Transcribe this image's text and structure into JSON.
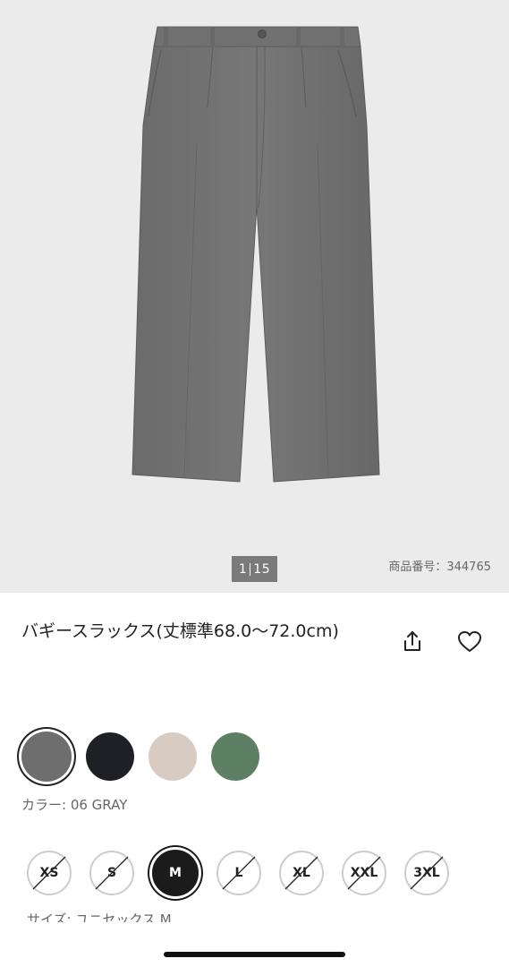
{
  "gallery": {
    "image_alt": "gray baggy slacks",
    "pager_current": "1",
    "pager_total": "15",
    "product_number": "商品番号：344765"
  },
  "product": {
    "title": "バギースラックス(丈標準68.0～72.0cm)",
    "share_icon": "share-icon",
    "favorite_icon": "heart-icon"
  },
  "colors": {
    "swatches": [
      {
        "name": "06 GRAY",
        "hex": "#6e6e6e",
        "selected": true
      },
      {
        "name": "black",
        "hex": "#1f2025",
        "selected": false
      },
      {
        "name": "beige",
        "hex": "#d8ccc2",
        "selected": false
      },
      {
        "name": "green",
        "hex": "#5d7f63",
        "selected": false
      }
    ],
    "label": "カラー: 06 GRAY"
  },
  "sizes": {
    "options": [
      {
        "label": "XS",
        "available": false,
        "selected": false
      },
      {
        "label": "S",
        "available": false,
        "selected": false
      },
      {
        "label": "M",
        "available": true,
        "selected": true
      },
      {
        "label": "L",
        "available": false,
        "selected": false
      },
      {
        "label": "XL",
        "available": false,
        "selected": false
      },
      {
        "label": "XXL",
        "available": false,
        "selected": false
      },
      {
        "label": "3XL",
        "available": false,
        "selected": false
      }
    ],
    "label": "サイズ: ユニセックス M"
  }
}
